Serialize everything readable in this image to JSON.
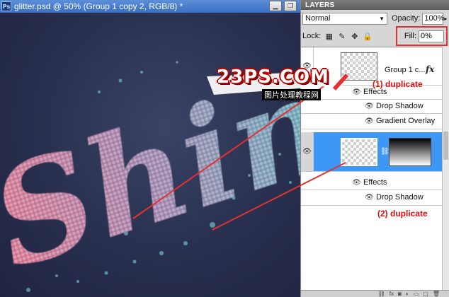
{
  "document": {
    "title": "glitter.psd @ 50% (Group 1 copy 2, RGB/8) *",
    "app_badge": "Ps",
    "canvas_text": "Shin"
  },
  "panel": {
    "tab": "LAYERS",
    "blend_mode": "Normal",
    "opacity_label": "Opacity:",
    "opacity_value": "100%",
    "lock_label": "Lock:",
    "fill_label": "Fill:",
    "fill_value": "0%"
  },
  "layers": [
    {
      "name": "Group 1 c...",
      "fx": "fx",
      "effects_label": "Effects",
      "effects": [
        "Drop Shadow",
        "Gradient Overlay"
      ]
    },
    {
      "effects_label": "Effects",
      "effects": [
        "Drop Shadow"
      ]
    }
  ],
  "annotations": {
    "note_1": "(1) duplicate",
    "note_2": "(2) duplicate",
    "watermark": "23PS.COM",
    "watermark_sub": "图片处理教程网"
  },
  "colors": {
    "selection": "#3d97f5",
    "annotation": "#e53030",
    "titlebar": "#4a80cf"
  },
  "icons": {
    "eye": "eye-icon",
    "chain": "link-icon",
    "fx": "fx-icon"
  }
}
